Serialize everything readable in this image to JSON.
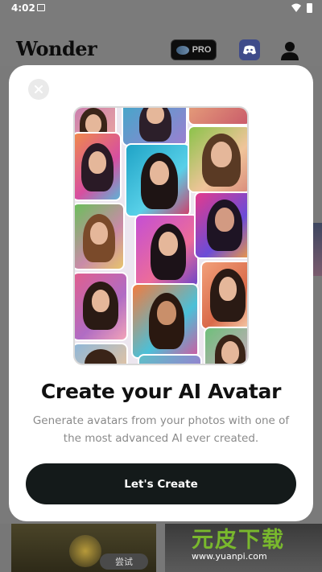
{
  "status_bar": {
    "time": "4:02",
    "icons": [
      "image-icon",
      "wifi-icon",
      "battery-icon"
    ]
  },
  "app": {
    "logo": "Wonder",
    "pro_label": "PRO",
    "icons": [
      "pro-logo-icon",
      "discord-icon",
      "user-icon"
    ]
  },
  "background": {
    "try_badge": "尝试",
    "watermark_text": "元皮下载",
    "watermark_url": "www.yuanpi.com"
  },
  "modal": {
    "close_icon": "close-icon",
    "title": "Create your AI Avatar",
    "subtitle": "Generate avatars from your photos with one of the most advanced AI ever created.",
    "cta_label": "Let's Create"
  },
  "colors": {
    "overlay": "#7a7a7a",
    "modal_bg": "#ffffff",
    "cta_bg": "#141a1a",
    "subtitle": "#8a8a8a",
    "discord": "#3f4b8a",
    "watermark_green": "#79b82d"
  }
}
